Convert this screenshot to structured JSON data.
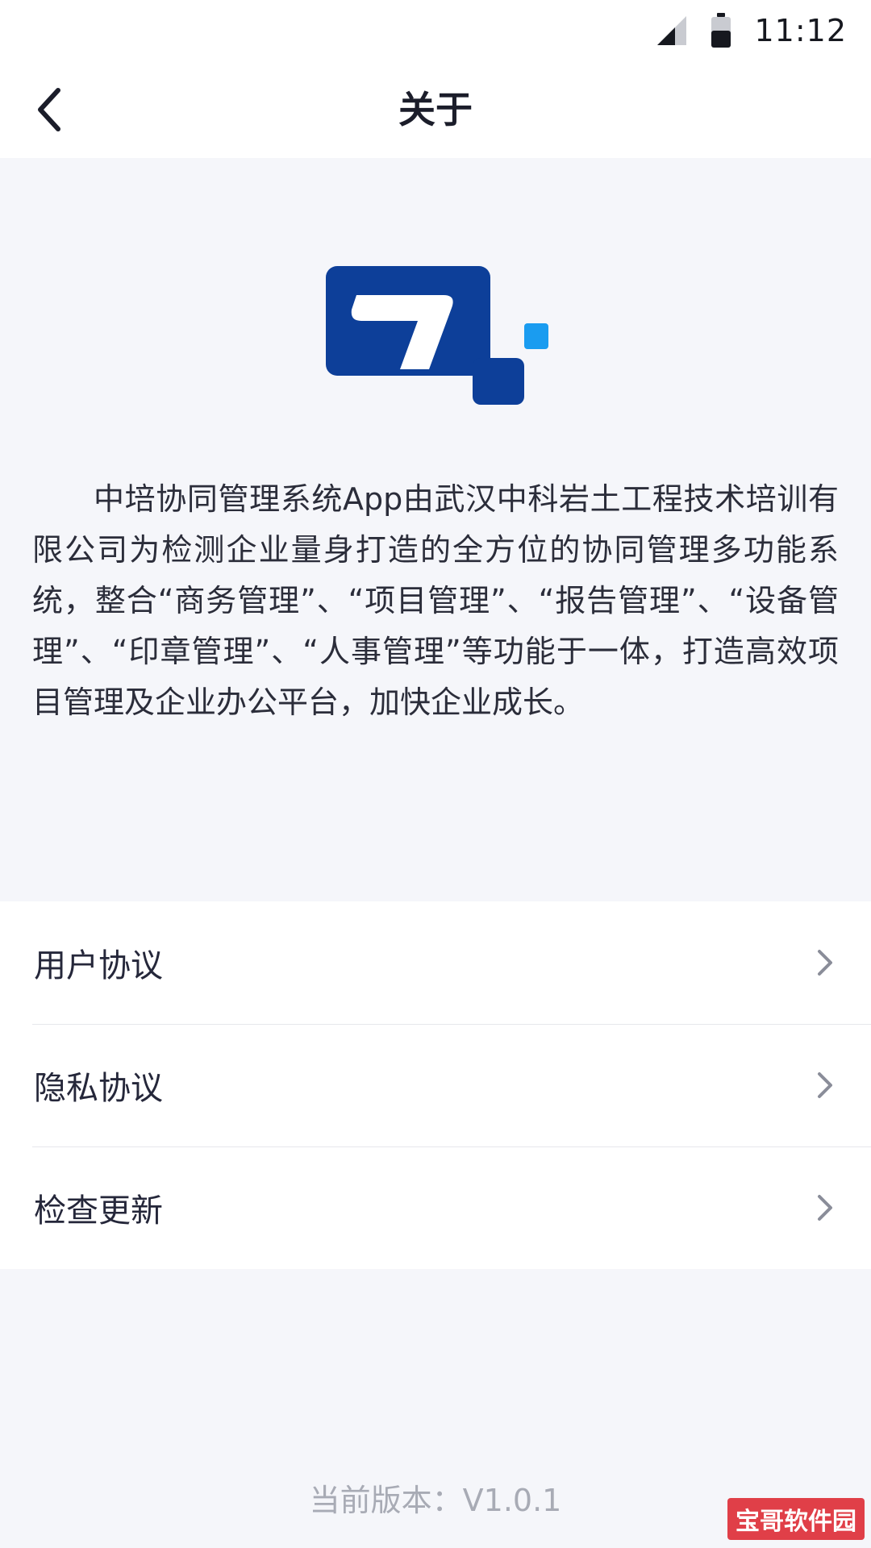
{
  "status_bar": {
    "time": "11:12"
  },
  "header": {
    "title": "关于"
  },
  "about": {
    "description": "中培协同管理系统App由武汉中科岩土工程技术培训有限公司为检测企业量身打造的全方位的协同管理多功能系统，整合“商务管理”、“项目管理”、“报告管理”、“设备管理”、“印章管理”、“人事管理”等功能于一体，打造高效项目管理及企业办公平台，加快企业成长。"
  },
  "menu": {
    "items": [
      {
        "label": "用户协议"
      },
      {
        "label": "隐私协议"
      },
      {
        "label": "检查更新"
      }
    ]
  },
  "footer": {
    "version": "当前版本：V1.0.1"
  },
  "watermark": {
    "text": "宝哥软件园"
  },
  "colors": {
    "brand_dark_blue": "#0d3f99",
    "brand_light_blue": "#1a9cf0",
    "page_background": "#f5f6fa"
  },
  "icons": {
    "back": "chevron-left-icon",
    "menu_arrow": "chevron-right-icon",
    "signal": "signal-icon",
    "battery": "battery-icon"
  }
}
